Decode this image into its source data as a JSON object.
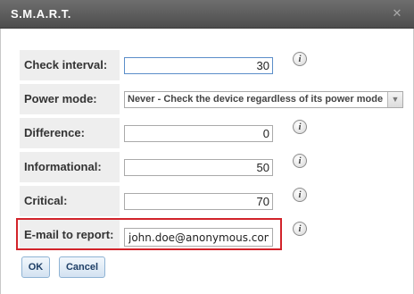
{
  "window": {
    "title": "S.M.A.R.T.",
    "close_icon": "close-icon"
  },
  "fields": {
    "check_interval": {
      "label": "Check interval:",
      "value": "30"
    },
    "power_mode": {
      "label": "Power mode:",
      "value": "Never - Check the device regardless of its power mode"
    },
    "difference": {
      "label": "Difference:",
      "value": "0"
    },
    "informational": {
      "label": "Informational:",
      "value": "50"
    },
    "critical": {
      "label": "Critical:",
      "value": "70"
    },
    "email": {
      "label": "E-mail to report:",
      "value": "john.doe@anonymous.com"
    }
  },
  "info_glyph": "i",
  "buttons": {
    "ok": "OK",
    "cancel": "Cancel"
  },
  "colors": {
    "highlight": "#d2232a",
    "titlebar": "#555555",
    "label_bg": "#eeeeee"
  }
}
